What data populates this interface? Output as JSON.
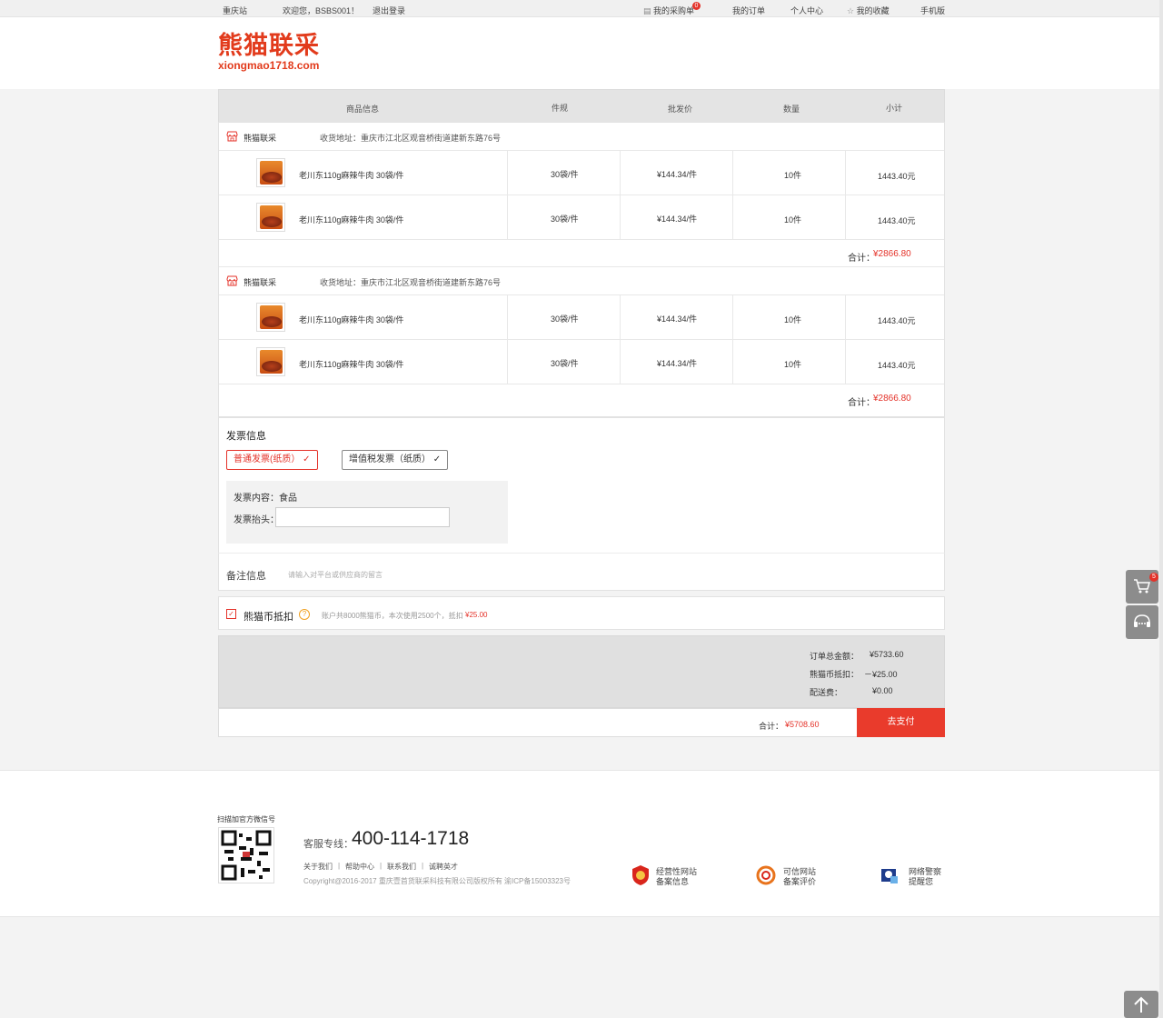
{
  "topbar": {
    "city": "重庆站",
    "welcome": "欢迎您，BSBS001！",
    "logout": "退出登录",
    "cart": "我的采购单",
    "cart_count": "0",
    "orders": "我的订单",
    "center": "个人中心",
    "favorites": "我的收藏",
    "mobile": "手机版"
  },
  "logo": {
    "cn": "熊猫联采",
    "en": "xiongmao1718.com"
  },
  "table_header": {
    "info": "商品信息",
    "spec": "件规",
    "price": "批发价",
    "qty": "数量",
    "subtotal": "小计"
  },
  "groups": [
    {
      "shop": "熊猫联采",
      "address": "收货地址：重庆市江北区观音桥街道建新东路76号",
      "items": [
        {
          "name": "老川东110g麻辣牛肉 30袋/件",
          "spec": "30袋/件",
          "price": "¥144.34/件",
          "qty": "10件",
          "subtotal": "1443.40元"
        },
        {
          "name": "老川东110g麻辣牛肉 30袋/件",
          "spec": "30袋/件",
          "price": "¥144.34/件",
          "qty": "10件",
          "subtotal": "1443.40元"
        }
      ],
      "total_label": "合计：",
      "total": "¥2866.80"
    },
    {
      "shop": "熊猫联采",
      "address": "收货地址：重庆市江北区观音桥街道建新东路76号",
      "items": [
        {
          "name": "老川东110g麻辣牛肉 30袋/件",
          "spec": "30袋/件",
          "price": "¥144.34/件",
          "qty": "10件",
          "subtotal": "1443.40元"
        },
        {
          "name": "老川东110g麻辣牛肉 30袋/件",
          "spec": "30袋/件",
          "price": "¥144.34/件",
          "qty": "10件",
          "subtotal": "1443.40元"
        }
      ],
      "total_label": "合计：",
      "total": "¥2866.80"
    }
  ],
  "invoice": {
    "title": "发票信息",
    "option1": "普通发票(纸质）",
    "option2": "增值税发票（纸质）",
    "content_label": "发票内容：食品",
    "header_label": "发票抬头：",
    "header_value": ""
  },
  "remark": {
    "label": "备注信息",
    "placeholder": "请输入对平台或供应商的留言"
  },
  "coin": {
    "label": "熊猫币抵扣",
    "desc": "账户共8000熊猫币，本次使用2500个，抵扣",
    "amount": "¥25.00"
  },
  "summary": {
    "total_label": "订单总金额：",
    "total": "¥5733.60",
    "coin_label": "熊猫币抵扣：",
    "coin": "－¥25.00",
    "ship_label": "配送费：",
    "ship": "¥0.00"
  },
  "pay": {
    "label": "合计：",
    "amount": "¥5708.60",
    "button": "去支付"
  },
  "footer": {
    "qr_label": "扫描加官方微信号",
    "hotline_label": "客服专线：",
    "hotline": "400-114-1718",
    "links": [
      "关于我们",
      "帮助中心",
      "联系我们",
      "诚聘英才"
    ],
    "copyright": "Copyright@2016-2017 重庆壹首货联采科技有限公司版权所有 渝ICP备15003323号",
    "badge1": [
      "经营性网站",
      "备案信息"
    ],
    "badge2": [
      "可信网站",
      "备案评价"
    ],
    "badge3": [
      "网络警察",
      "提醒您"
    ]
  },
  "side": {
    "cart_count": "5"
  }
}
